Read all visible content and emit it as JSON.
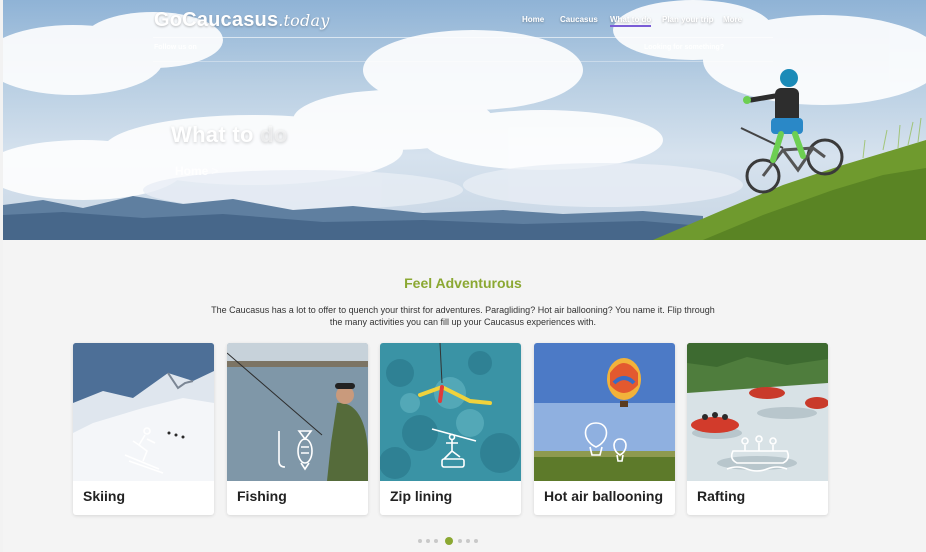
{
  "header": {
    "logo_main": "GoCaucasus",
    "logo_tld": ".today",
    "nav": [
      {
        "label": "Home"
      },
      {
        "label": "Caucasus"
      },
      {
        "label": "What to do"
      },
      {
        "label": "Plan your trip"
      },
      {
        "label": "More"
      }
    ],
    "follow_label": "Follow us on",
    "looking_label": "Looking for something?"
  },
  "hero": {
    "title_main": "What to ",
    "title_accent": "do",
    "breadcrumb": "Home",
    "breadcrumb_sep": ">"
  },
  "section": {
    "title": "Feel Adventurous",
    "intro_line1": "The Caucasus has a lot to offer to quench your thirst for adventures. Paragliding? Hot air ballooning? You name it. Flip through",
    "intro_line2": "the many activities you can fill up your Caucasus experiences with."
  },
  "cards": [
    {
      "label": "Skiing",
      "icon": "skiing-icon"
    },
    {
      "label": "Fishing",
      "icon": "fishing-icon"
    },
    {
      "label": "Zip lining",
      "icon": "zipline-icon"
    },
    {
      "label": "Hot air ballooning",
      "icon": "hot-air-balloon-icon"
    },
    {
      "label": "Rafting",
      "icon": "rafting-icon"
    }
  ],
  "carousel": {
    "pages": 7,
    "active": 3
  },
  "colors": {
    "accent": "#8ba832",
    "nav_active": "#7a5cd6"
  }
}
